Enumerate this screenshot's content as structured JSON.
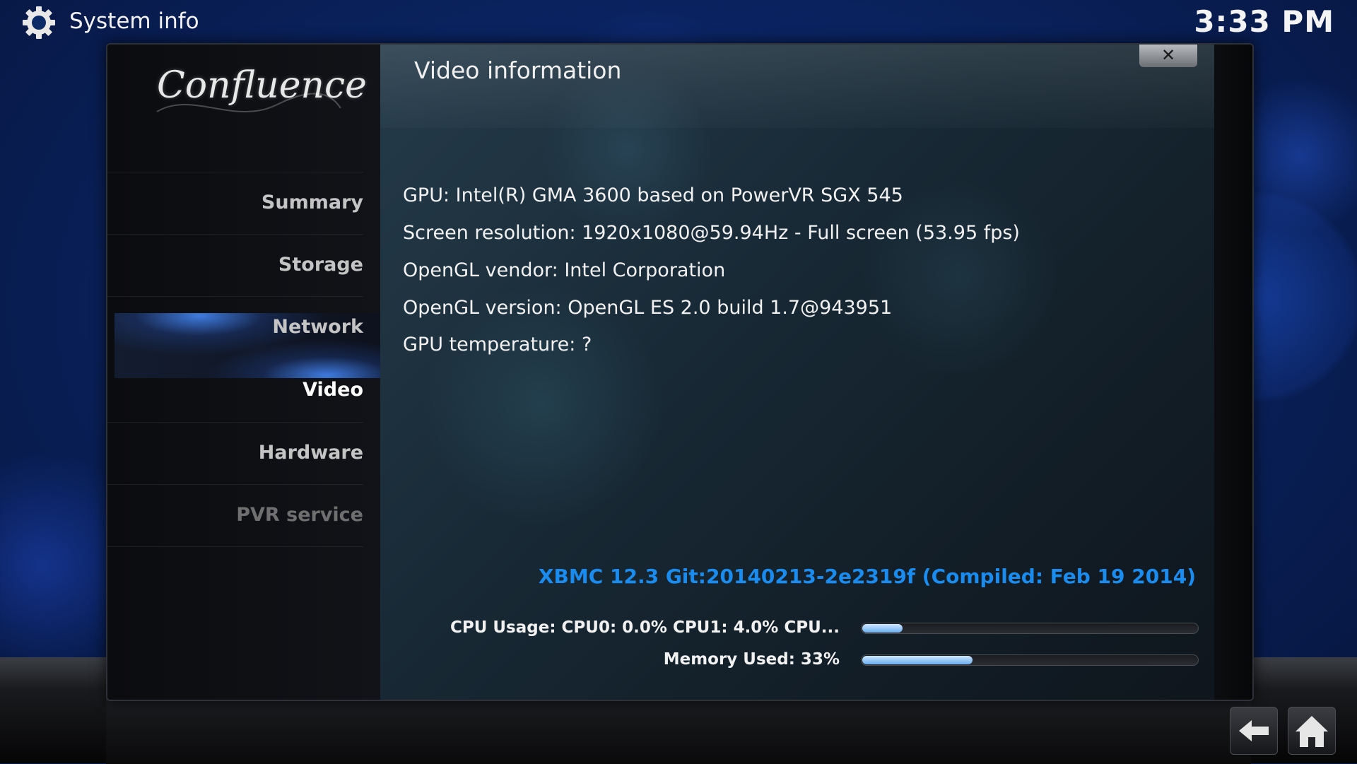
{
  "header": {
    "title": "System info",
    "clock": "3:33 PM"
  },
  "sidebar": {
    "logo_text": "Confluence",
    "items": [
      {
        "label": "Summary"
      },
      {
        "label": "Storage"
      },
      {
        "label": "Network"
      },
      {
        "label": "Video",
        "active": true
      },
      {
        "label": "Hardware"
      },
      {
        "label": "PVR service",
        "disabled": true
      }
    ]
  },
  "dialog": {
    "title": "Video information",
    "close_icon": "close-x-icon",
    "info_lines": [
      "GPU: Intel(R) GMA 3600 based on PowerVR SGX 545",
      "Screen resolution: 1920x1080@59.94Hz - Full screen (53.95 fps)",
      "OpenGL vendor: Intel Corporation",
      "OpenGL version: OpenGL ES 2.0 build 1.7@943951",
      "GPU temperature: ?"
    ],
    "version": "XBMC 12.3 Git:20140213-2e2319f (Compiled: Feb 19 2014)",
    "cpu_label": "CPU Usage: CPU0: 0.0% CPU1: 4.0% CPU...",
    "cpu_fraction": 0.12,
    "memory_label": "Memory Used: 33%",
    "memory_fraction": 0.33
  },
  "footer": {
    "back_icon": "back-arrow-icon",
    "home_icon": "home-icon"
  },
  "colors": {
    "accent_blue": "#1a8cf0",
    "background": "#0a2360"
  }
}
